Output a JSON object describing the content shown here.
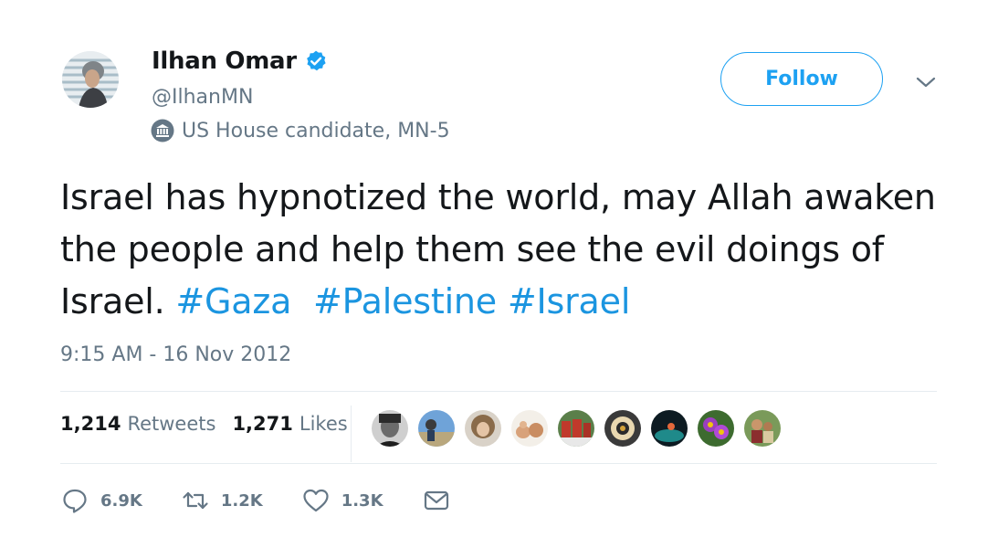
{
  "author": {
    "display_name": "Ilhan Omar",
    "handle": "@IlhanMN",
    "label": "US House candidate, MN-5",
    "verified": true
  },
  "follow_button": {
    "label": "Follow"
  },
  "tweet": {
    "text_plain": "Israel has hypnotized the world, may Allah awaken the people and help them see the evil doings of Israel.",
    "hashtags": [
      "#Gaza",
      "#Palestine",
      "#Israel"
    ],
    "timestamp": "9:15 AM - 16 Nov 2012"
  },
  "stats": {
    "retweets_count": "1,214",
    "retweets_label": "Retweets",
    "likes_count": "1,271",
    "likes_label": "Likes"
  },
  "actions": {
    "reply_count": "6.9K",
    "retweet_count": "1.2K",
    "like_count": "1.3K"
  },
  "colors": {
    "accent": "#1da1f2",
    "hashtag": "#1b95e0",
    "secondary_text": "#657786",
    "primary_text": "#14171a",
    "divider": "#e6ecf0"
  },
  "liker_avatars": [
    "avatar-man-dark",
    "avatar-outdoor-sky",
    "avatar-curly-hair",
    "avatar-cats",
    "avatar-group-red",
    "avatar-pattern",
    "avatar-teal-dark",
    "avatar-purple-flowers",
    "avatar-family"
  ]
}
